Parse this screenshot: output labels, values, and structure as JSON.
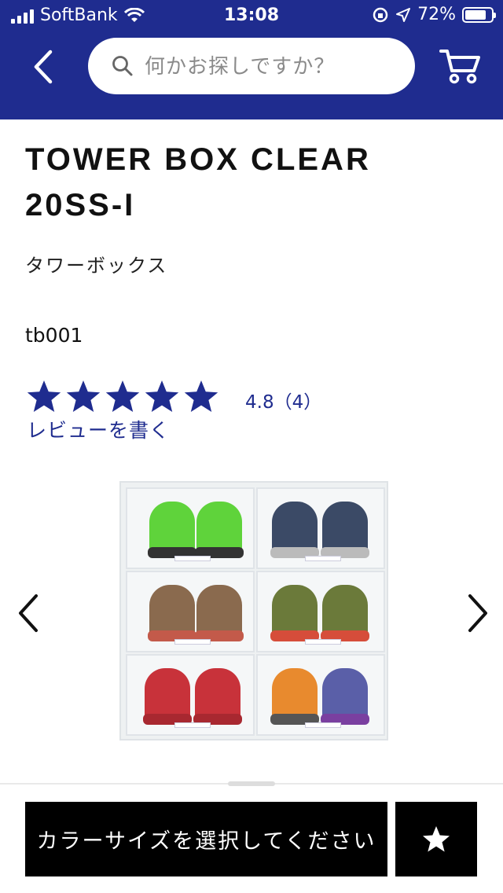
{
  "status_bar": {
    "carrier": "SoftBank",
    "time": "13:08",
    "battery": "72%",
    "battery_level": 0.72
  },
  "header": {
    "search_placeholder": "何かお探しですか？"
  },
  "product": {
    "name": "TOWER BOX CLEAR 20SS-I",
    "brand": "タワーボックス",
    "sku": "tb001",
    "rating_text": "4.8（4）",
    "rating_value": 4.8,
    "rating_max": 5,
    "review_link": "レビューを書く"
  },
  "footer": {
    "select_button": "カラーサイズを選択してください"
  },
  "colors": {
    "brand_blue": "#1f2c8f",
    "button_black": "#000000"
  },
  "icons": [
    "back-chevron-icon",
    "search-icon",
    "cart-icon",
    "star-icon",
    "chevron-left-icon",
    "chevron-right-icon"
  ]
}
